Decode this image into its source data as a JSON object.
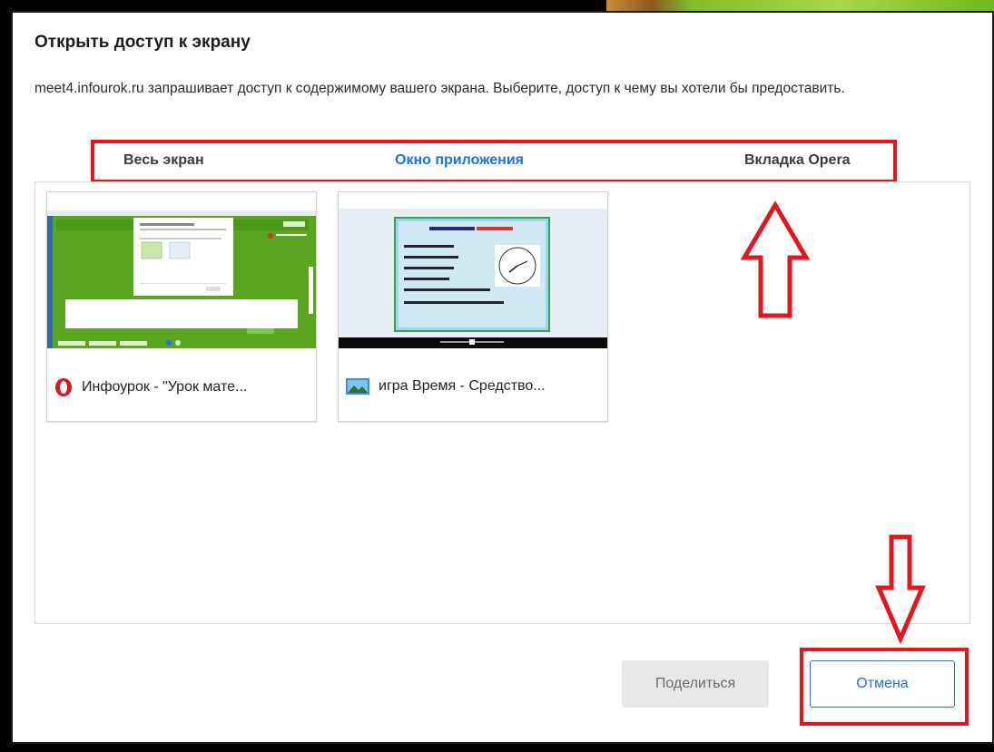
{
  "dialog": {
    "title": "Открыть доступ к экрану",
    "description": "meet4.infourok.ru запрашивает доступ к содержимому вашего экрана. Выберите, доступ к чему вы хотели бы предоставить."
  },
  "tabs": [
    {
      "label": "Весь экран",
      "active": false
    },
    {
      "label": "Окно приложения",
      "active": true
    },
    {
      "label": "Вкладка Opera",
      "active": false
    }
  ],
  "windows": [
    {
      "title": "Инфоурок - \"Урок мате...",
      "icon": "opera-icon"
    },
    {
      "title": "игра Время - Средство...",
      "icon": "image-viewer-icon"
    }
  ],
  "buttons": {
    "share": "Поделиться",
    "cancel": "Отмена"
  },
  "colors": {
    "accent": "#1a73e8",
    "highlight": "#e8141c",
    "share_disabled_bg": "#e8e8e8"
  }
}
